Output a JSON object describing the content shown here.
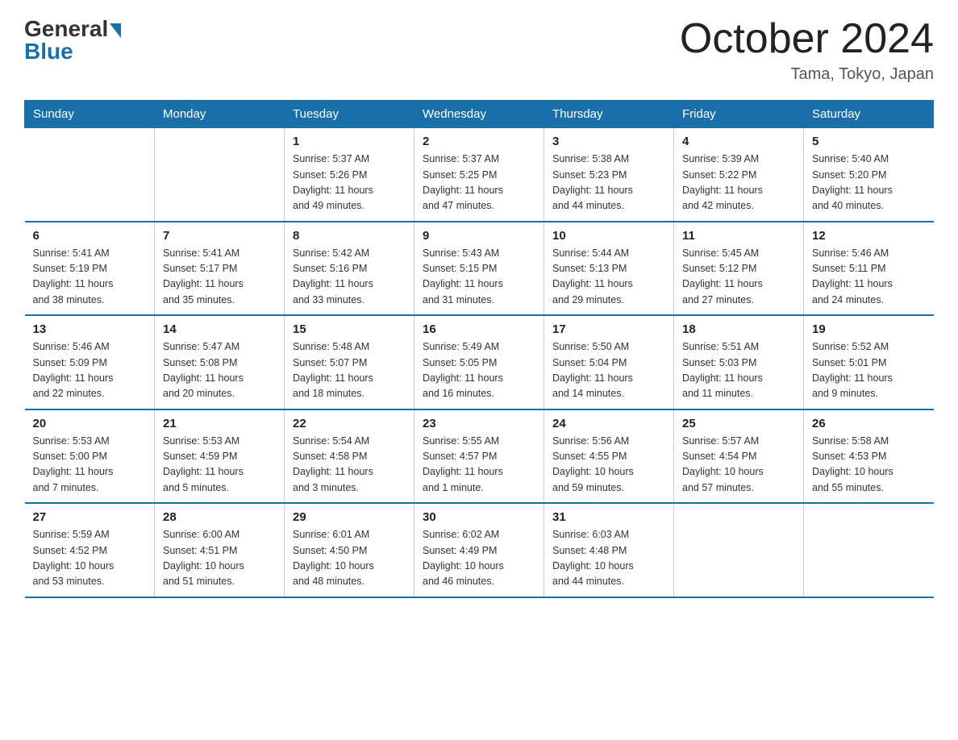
{
  "header": {
    "logo_general": "General",
    "logo_blue": "Blue",
    "title": "October 2024",
    "subtitle": "Tama, Tokyo, Japan"
  },
  "calendar": {
    "days_of_week": [
      "Sunday",
      "Monday",
      "Tuesday",
      "Wednesday",
      "Thursday",
      "Friday",
      "Saturday"
    ],
    "weeks": [
      [
        {
          "day": "",
          "info": ""
        },
        {
          "day": "",
          "info": ""
        },
        {
          "day": "1",
          "info": "Sunrise: 5:37 AM\nSunset: 5:26 PM\nDaylight: 11 hours\nand 49 minutes."
        },
        {
          "day": "2",
          "info": "Sunrise: 5:37 AM\nSunset: 5:25 PM\nDaylight: 11 hours\nand 47 minutes."
        },
        {
          "day": "3",
          "info": "Sunrise: 5:38 AM\nSunset: 5:23 PM\nDaylight: 11 hours\nand 44 minutes."
        },
        {
          "day": "4",
          "info": "Sunrise: 5:39 AM\nSunset: 5:22 PM\nDaylight: 11 hours\nand 42 minutes."
        },
        {
          "day": "5",
          "info": "Sunrise: 5:40 AM\nSunset: 5:20 PM\nDaylight: 11 hours\nand 40 minutes."
        }
      ],
      [
        {
          "day": "6",
          "info": "Sunrise: 5:41 AM\nSunset: 5:19 PM\nDaylight: 11 hours\nand 38 minutes."
        },
        {
          "day": "7",
          "info": "Sunrise: 5:41 AM\nSunset: 5:17 PM\nDaylight: 11 hours\nand 35 minutes."
        },
        {
          "day": "8",
          "info": "Sunrise: 5:42 AM\nSunset: 5:16 PM\nDaylight: 11 hours\nand 33 minutes."
        },
        {
          "day": "9",
          "info": "Sunrise: 5:43 AM\nSunset: 5:15 PM\nDaylight: 11 hours\nand 31 minutes."
        },
        {
          "day": "10",
          "info": "Sunrise: 5:44 AM\nSunset: 5:13 PM\nDaylight: 11 hours\nand 29 minutes."
        },
        {
          "day": "11",
          "info": "Sunrise: 5:45 AM\nSunset: 5:12 PM\nDaylight: 11 hours\nand 27 minutes."
        },
        {
          "day": "12",
          "info": "Sunrise: 5:46 AM\nSunset: 5:11 PM\nDaylight: 11 hours\nand 24 minutes."
        }
      ],
      [
        {
          "day": "13",
          "info": "Sunrise: 5:46 AM\nSunset: 5:09 PM\nDaylight: 11 hours\nand 22 minutes."
        },
        {
          "day": "14",
          "info": "Sunrise: 5:47 AM\nSunset: 5:08 PM\nDaylight: 11 hours\nand 20 minutes."
        },
        {
          "day": "15",
          "info": "Sunrise: 5:48 AM\nSunset: 5:07 PM\nDaylight: 11 hours\nand 18 minutes."
        },
        {
          "day": "16",
          "info": "Sunrise: 5:49 AM\nSunset: 5:05 PM\nDaylight: 11 hours\nand 16 minutes."
        },
        {
          "day": "17",
          "info": "Sunrise: 5:50 AM\nSunset: 5:04 PM\nDaylight: 11 hours\nand 14 minutes."
        },
        {
          "day": "18",
          "info": "Sunrise: 5:51 AM\nSunset: 5:03 PM\nDaylight: 11 hours\nand 11 minutes."
        },
        {
          "day": "19",
          "info": "Sunrise: 5:52 AM\nSunset: 5:01 PM\nDaylight: 11 hours\nand 9 minutes."
        }
      ],
      [
        {
          "day": "20",
          "info": "Sunrise: 5:53 AM\nSunset: 5:00 PM\nDaylight: 11 hours\nand 7 minutes."
        },
        {
          "day": "21",
          "info": "Sunrise: 5:53 AM\nSunset: 4:59 PM\nDaylight: 11 hours\nand 5 minutes."
        },
        {
          "day": "22",
          "info": "Sunrise: 5:54 AM\nSunset: 4:58 PM\nDaylight: 11 hours\nand 3 minutes."
        },
        {
          "day": "23",
          "info": "Sunrise: 5:55 AM\nSunset: 4:57 PM\nDaylight: 11 hours\nand 1 minute."
        },
        {
          "day": "24",
          "info": "Sunrise: 5:56 AM\nSunset: 4:55 PM\nDaylight: 10 hours\nand 59 minutes."
        },
        {
          "day": "25",
          "info": "Sunrise: 5:57 AM\nSunset: 4:54 PM\nDaylight: 10 hours\nand 57 minutes."
        },
        {
          "day": "26",
          "info": "Sunrise: 5:58 AM\nSunset: 4:53 PM\nDaylight: 10 hours\nand 55 minutes."
        }
      ],
      [
        {
          "day": "27",
          "info": "Sunrise: 5:59 AM\nSunset: 4:52 PM\nDaylight: 10 hours\nand 53 minutes."
        },
        {
          "day": "28",
          "info": "Sunrise: 6:00 AM\nSunset: 4:51 PM\nDaylight: 10 hours\nand 51 minutes."
        },
        {
          "day": "29",
          "info": "Sunrise: 6:01 AM\nSunset: 4:50 PM\nDaylight: 10 hours\nand 48 minutes."
        },
        {
          "day": "30",
          "info": "Sunrise: 6:02 AM\nSunset: 4:49 PM\nDaylight: 10 hours\nand 46 minutes."
        },
        {
          "day": "31",
          "info": "Sunrise: 6:03 AM\nSunset: 4:48 PM\nDaylight: 10 hours\nand 44 minutes."
        },
        {
          "day": "",
          "info": ""
        },
        {
          "day": "",
          "info": ""
        }
      ]
    ]
  }
}
